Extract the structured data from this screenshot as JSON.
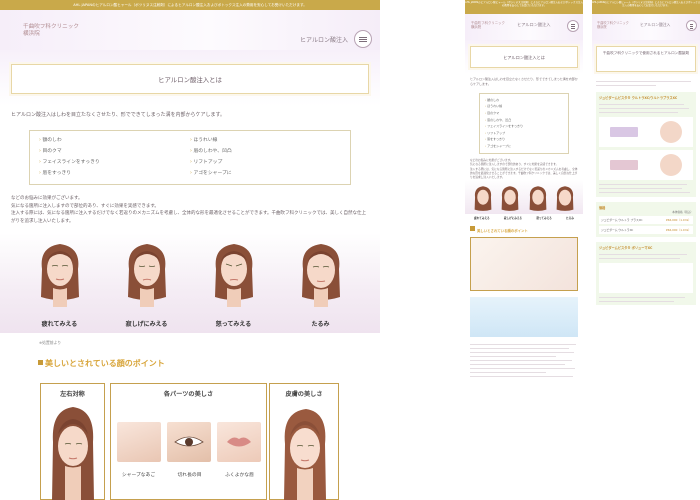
{
  "notice": "AHL JAPANのヒアルロン酸ヒャール（ボツリヌス注射剤）によるヒアルロン酸注入およびボトックス注入の費用を安心してお受けいただけます。",
  "header": {
    "logo_line1": "千曲吹フ科クリニック",
    "logo_line2": "横浜院",
    "link": "ヒアルロン酸注入"
  },
  "page_title": "ヒアルロン酸注入とは",
  "intro": "ヒアルロン酸注入はしわを目立たなくさせたり、形でできてしまった溝を内部からケアします。",
  "targets": [
    "額のしわ",
    "ほうれい線",
    "目のクマ",
    "眉のしわや、凹凸",
    "フェイスラインをすっきり",
    "リフトアップ",
    "唇をすっきり",
    "アゴをシャープに"
  ],
  "para2": [
    "などのお悩みに効果がございます。",
    "気になる箇所に注入しますので部位的あり、すぐに効果を実感できます。",
    "注入する際には、気になる箇所に注入するだけでなく若返りのメカニズムを考慮し、全体的な形を最適化させることができます。千曲吹フ科クリニックでは、美しく自然な仕上がりを追求し注入いたします。"
  ],
  "faces": [
    {
      "caption": "疲れてみえる"
    },
    {
      "caption": "寂しげにみえる"
    },
    {
      "caption": "怒ってみえる"
    },
    {
      "caption": "たるみ"
    }
  ],
  "note": "※処置前より",
  "section_heading": "美しいとされている顔のポイント",
  "points": {
    "box1": "左右対称",
    "box2": "各パーツの美しさ",
    "box3": "皮膚の美しさ",
    "sub": [
      "シャープなあご",
      "切れ長の目",
      "ふくよかな唇"
    ]
  },
  "mobile1": {
    "logo_line1": "千曲吹フ科クリニック",
    "logo_line2": "横浜院",
    "link": "ヒアルロン酸注入",
    "title": "ヒアルロン酸注入とは"
  },
  "mobile2": {
    "logo_line1": "千曲吹フ科クリニック",
    "logo_line2": "横浜院",
    "link": "ヒアルロン酸注入",
    "title": "千曲吹フ科クリニックで使用されるヒアルロン酸製剤",
    "item1": "ジュビダームビスタ® ウルトラXC/ウルトラプラスXC",
    "item2": "価格",
    "item3": "ジュビダームビスタ® ボリューマXC",
    "price1": "¥66,000（1.0ml）",
    "price2": "¥66,000（1.0ml）",
    "spec1": "ジュビダーム ウルトラ プラスXC",
    "spec2": "ジュビダーム ウルトラXC",
    "col_head": "本体価格（税込）"
  },
  "colors": {
    "gold": "#c9a94a",
    "plum": "#b08a8f",
    "lavender": "#f5edf8"
  }
}
